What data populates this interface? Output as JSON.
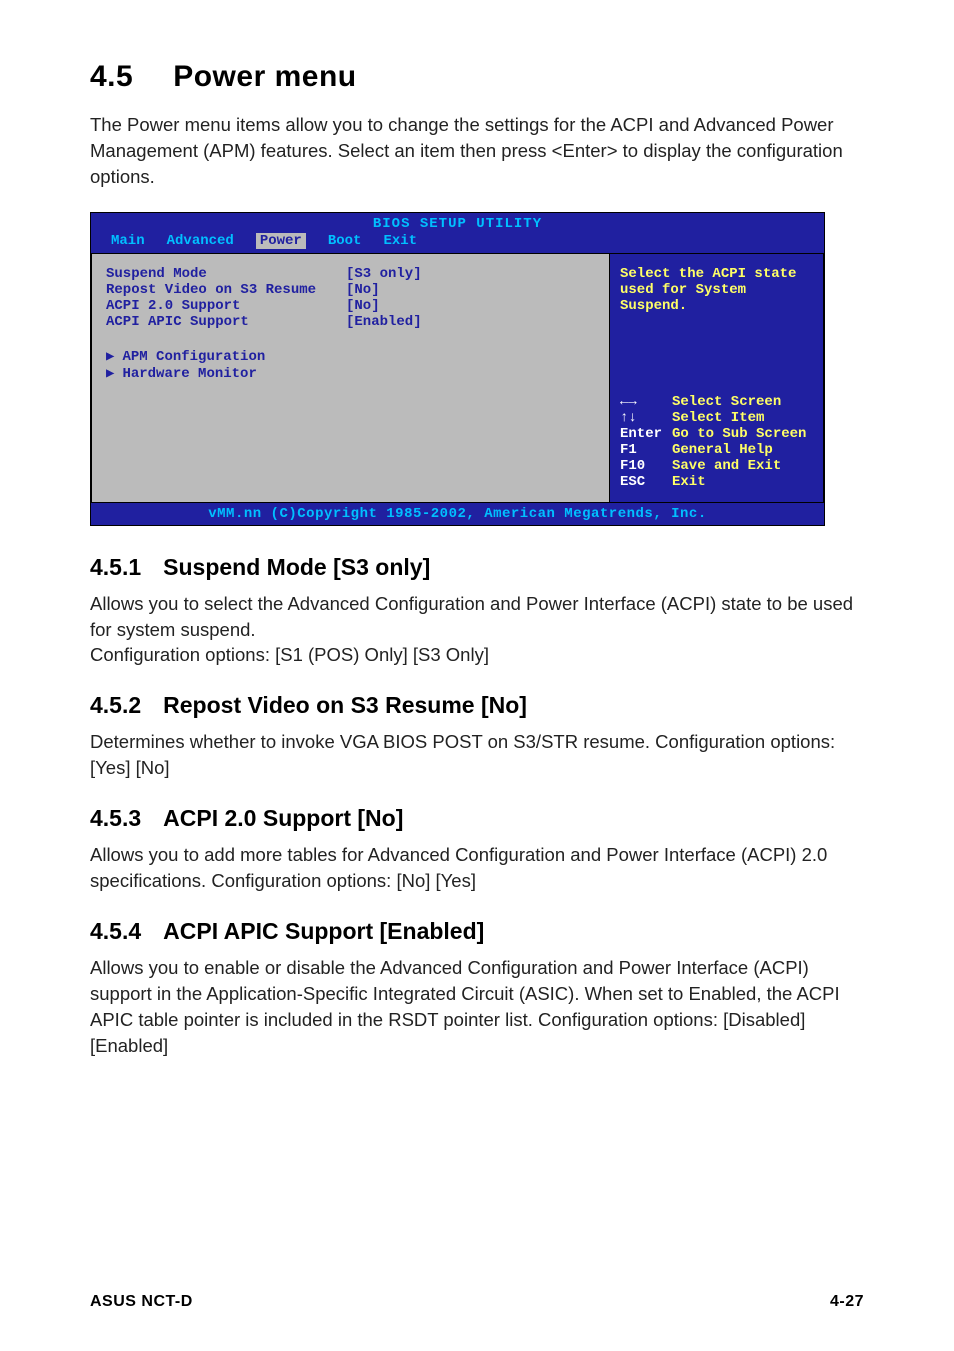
{
  "heading": {
    "num": "4.5",
    "title": "Power menu"
  },
  "intro": "The Power menu items allow you to change the settings for the ACPI and Advanced Power Management (APM) features. Select an item then press <Enter> to display the configuration options.",
  "bios": {
    "title": "BIOS SETUP UTILITY",
    "tabs": [
      "Main",
      "Advanced",
      "Power",
      "Boot",
      "Exit"
    ],
    "active_tab": "Power",
    "items": [
      {
        "label": "Suspend Mode",
        "value": "[S3 only]"
      },
      {
        "label": "Repost Video on S3 Resume",
        "value": "[No]"
      },
      {
        "label": "ACPI 2.0 Support",
        "value": "[No]"
      },
      {
        "label": "ACPI APIC Support",
        "value": "[Enabled]"
      }
    ],
    "submenus": [
      "APM Configuration",
      "Hardware Monitor"
    ],
    "help_text": "Select the ACPI state used for System Suspend.",
    "nav": [
      {
        "key": "←→",
        "desc": "Select Screen"
      },
      {
        "key": "↑↓",
        "desc": "Select Item"
      },
      {
        "key": "Enter",
        "desc": "Go to Sub Screen"
      },
      {
        "key": "F1",
        "desc": "General Help"
      },
      {
        "key": "F10",
        "desc": "Save and Exit"
      },
      {
        "key": "ESC",
        "desc": "Exit"
      }
    ],
    "footer": "vMM.nn (C)Copyright 1985-2002, American Megatrends, Inc."
  },
  "sections": [
    {
      "num": "4.5.1",
      "title": "Suspend Mode [S3 only]",
      "body": "Allows you to select the Advanced Configuration and Power Interface (ACPI) state to be used for system suspend.\nConfiguration options: [S1 (POS) Only] [S3 Only]"
    },
    {
      "num": "4.5.2",
      "title": "Repost Video on S3 Resume [No]",
      "body": "Determines whether to invoke VGA BIOS POST on S3/STR resume. Configuration options: [Yes] [No]"
    },
    {
      "num": "4.5.3",
      "title": "ACPI 2.0 Support [No]",
      "body": "Allows you to add more tables for Advanced Configuration and Power Interface (ACPI) 2.0 specifications. Configuration options: [No] [Yes]"
    },
    {
      "num": "4.5.4",
      "title": "ACPI APIC Support [Enabled]",
      "body": "Allows you to enable or disable the Advanced Configuration and Power Interface (ACPI) support in the Application-Specific Integrated Circuit (ASIC). When set to Enabled, the ACPI APIC table pointer is included in the RSDT pointer list. Configuration options: [Disabled] [Enabled]"
    }
  ],
  "footer": {
    "left": "ASUS NCT-D",
    "right": "4-27"
  }
}
